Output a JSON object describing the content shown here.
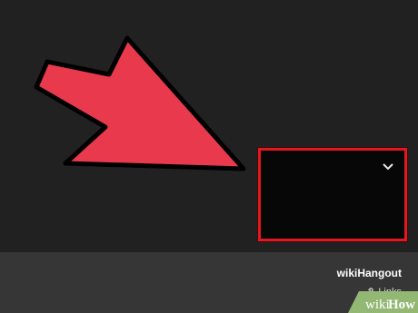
{
  "stage": {
    "pointer_icon": "red-arrow-icon"
  },
  "video_tile": {
    "dropdown_icon": "chevron-down-icon",
    "border_color": "#e0181f"
  },
  "footer": {
    "channel_name": "wikiHangout",
    "links_label": "Links",
    "links_icon": "link-icon"
  },
  "watermark": {
    "text_a": "wiki",
    "text_b": "How"
  },
  "colors": {
    "background": "#212121",
    "footer": "#363636",
    "arrow_fill": "#e83a4c",
    "watermark_green": "#93b874"
  }
}
